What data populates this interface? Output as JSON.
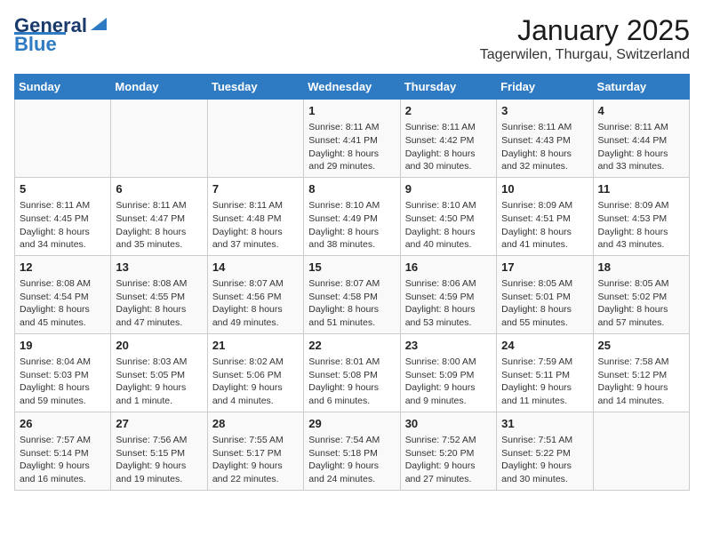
{
  "header": {
    "logo_line1": "General",
    "logo_line2": "Blue",
    "title": "January 2025",
    "subtitle": "Tagerwilen, Thurgau, Switzerland"
  },
  "days_of_week": [
    "Sunday",
    "Monday",
    "Tuesday",
    "Wednesday",
    "Thursday",
    "Friday",
    "Saturday"
  ],
  "weeks": [
    [
      {
        "day": "",
        "info": ""
      },
      {
        "day": "",
        "info": ""
      },
      {
        "day": "",
        "info": ""
      },
      {
        "day": "1",
        "info": "Sunrise: 8:11 AM\nSunset: 4:41 PM\nDaylight: 8 hours and 29 minutes."
      },
      {
        "day": "2",
        "info": "Sunrise: 8:11 AM\nSunset: 4:42 PM\nDaylight: 8 hours and 30 minutes."
      },
      {
        "day": "3",
        "info": "Sunrise: 8:11 AM\nSunset: 4:43 PM\nDaylight: 8 hours and 32 minutes."
      },
      {
        "day": "4",
        "info": "Sunrise: 8:11 AM\nSunset: 4:44 PM\nDaylight: 8 hours and 33 minutes."
      }
    ],
    [
      {
        "day": "5",
        "info": "Sunrise: 8:11 AM\nSunset: 4:45 PM\nDaylight: 8 hours and 34 minutes."
      },
      {
        "day": "6",
        "info": "Sunrise: 8:11 AM\nSunset: 4:47 PM\nDaylight: 8 hours and 35 minutes."
      },
      {
        "day": "7",
        "info": "Sunrise: 8:11 AM\nSunset: 4:48 PM\nDaylight: 8 hours and 37 minutes."
      },
      {
        "day": "8",
        "info": "Sunrise: 8:10 AM\nSunset: 4:49 PM\nDaylight: 8 hours and 38 minutes."
      },
      {
        "day": "9",
        "info": "Sunrise: 8:10 AM\nSunset: 4:50 PM\nDaylight: 8 hours and 40 minutes."
      },
      {
        "day": "10",
        "info": "Sunrise: 8:09 AM\nSunset: 4:51 PM\nDaylight: 8 hours and 41 minutes."
      },
      {
        "day": "11",
        "info": "Sunrise: 8:09 AM\nSunset: 4:53 PM\nDaylight: 8 hours and 43 minutes."
      }
    ],
    [
      {
        "day": "12",
        "info": "Sunrise: 8:08 AM\nSunset: 4:54 PM\nDaylight: 8 hours and 45 minutes."
      },
      {
        "day": "13",
        "info": "Sunrise: 8:08 AM\nSunset: 4:55 PM\nDaylight: 8 hours and 47 minutes."
      },
      {
        "day": "14",
        "info": "Sunrise: 8:07 AM\nSunset: 4:56 PM\nDaylight: 8 hours and 49 minutes."
      },
      {
        "day": "15",
        "info": "Sunrise: 8:07 AM\nSunset: 4:58 PM\nDaylight: 8 hours and 51 minutes."
      },
      {
        "day": "16",
        "info": "Sunrise: 8:06 AM\nSunset: 4:59 PM\nDaylight: 8 hours and 53 minutes."
      },
      {
        "day": "17",
        "info": "Sunrise: 8:05 AM\nSunset: 5:01 PM\nDaylight: 8 hours and 55 minutes."
      },
      {
        "day": "18",
        "info": "Sunrise: 8:05 AM\nSunset: 5:02 PM\nDaylight: 8 hours and 57 minutes."
      }
    ],
    [
      {
        "day": "19",
        "info": "Sunrise: 8:04 AM\nSunset: 5:03 PM\nDaylight: 8 hours and 59 minutes."
      },
      {
        "day": "20",
        "info": "Sunrise: 8:03 AM\nSunset: 5:05 PM\nDaylight: 9 hours and 1 minute."
      },
      {
        "day": "21",
        "info": "Sunrise: 8:02 AM\nSunset: 5:06 PM\nDaylight: 9 hours and 4 minutes."
      },
      {
        "day": "22",
        "info": "Sunrise: 8:01 AM\nSunset: 5:08 PM\nDaylight: 9 hours and 6 minutes."
      },
      {
        "day": "23",
        "info": "Sunrise: 8:00 AM\nSunset: 5:09 PM\nDaylight: 9 hours and 9 minutes."
      },
      {
        "day": "24",
        "info": "Sunrise: 7:59 AM\nSunset: 5:11 PM\nDaylight: 9 hours and 11 minutes."
      },
      {
        "day": "25",
        "info": "Sunrise: 7:58 AM\nSunset: 5:12 PM\nDaylight: 9 hours and 14 minutes."
      }
    ],
    [
      {
        "day": "26",
        "info": "Sunrise: 7:57 AM\nSunset: 5:14 PM\nDaylight: 9 hours and 16 minutes."
      },
      {
        "day": "27",
        "info": "Sunrise: 7:56 AM\nSunset: 5:15 PM\nDaylight: 9 hours and 19 minutes."
      },
      {
        "day": "28",
        "info": "Sunrise: 7:55 AM\nSunset: 5:17 PM\nDaylight: 9 hours and 22 minutes."
      },
      {
        "day": "29",
        "info": "Sunrise: 7:54 AM\nSunset: 5:18 PM\nDaylight: 9 hours and 24 minutes."
      },
      {
        "day": "30",
        "info": "Sunrise: 7:52 AM\nSunset: 5:20 PM\nDaylight: 9 hours and 27 minutes."
      },
      {
        "day": "31",
        "info": "Sunrise: 7:51 AM\nSunset: 5:22 PM\nDaylight: 9 hours and 30 minutes."
      },
      {
        "day": "",
        "info": ""
      }
    ]
  ]
}
